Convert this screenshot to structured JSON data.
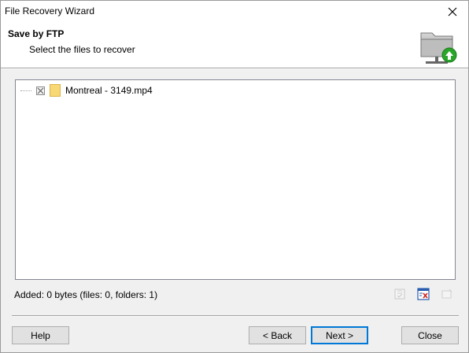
{
  "window": {
    "title": "File Recovery Wizard"
  },
  "header": {
    "title": "Save by FTP",
    "subtitle": "Select the files to recover",
    "icon": "folder-network-icon"
  },
  "tree": {
    "items": [
      {
        "label": "Montreal - 3149.mp4",
        "checked": "excluded",
        "icon": "folder-icon"
      }
    ]
  },
  "status": {
    "text": "Added: 0 bytes (files: 0, folders: 1)"
  },
  "toolbar": {
    "icons": [
      "check-all-icon",
      "uncheck-all-icon",
      "remove-icon"
    ]
  },
  "buttons": {
    "help": "Help",
    "back": "< Back",
    "next": "Next >",
    "close": "Close"
  },
  "colors": {
    "accent": "#0078d7",
    "folder": "#f8d775",
    "green_arrow": "#2aa52a"
  }
}
